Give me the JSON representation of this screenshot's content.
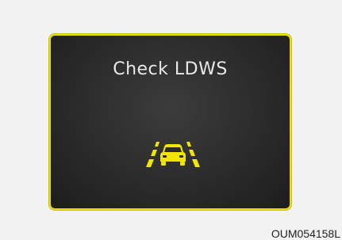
{
  "display": {
    "message": "Check LDWS",
    "icon": "lane-departure-warning-icon",
    "border_color": "#e7e000",
    "icon_color": "#f2e600",
    "text_color": "#e9e9e9"
  },
  "reference_code": "OUM054158L"
}
